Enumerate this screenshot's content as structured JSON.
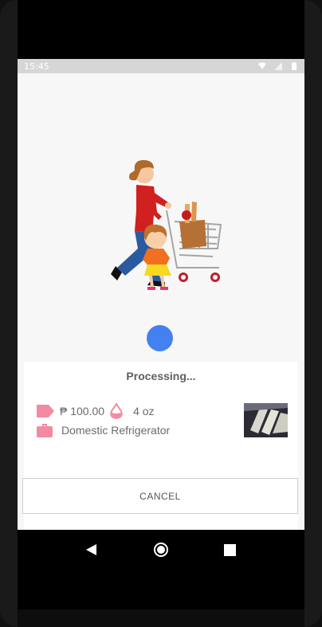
{
  "status_bar": {
    "time": "15:45",
    "icons": [
      "wifi-icon",
      "signal-icon",
      "battery-icon"
    ]
  },
  "illustration": {
    "icon": "mother-child-shopping-cart-illustration"
  },
  "loader": {
    "color": "#4380f0"
  },
  "sheet": {
    "title": "Processing...",
    "price": "₱ 100.00",
    "weight": "4 oz",
    "category": "Domestic Refrigerator",
    "icon_color": "#f48aa2",
    "cancel_label": "CANCEL"
  },
  "nav": {
    "back_icon": "back-icon",
    "home_icon": "home-icon",
    "recents_icon": "recents-icon"
  }
}
